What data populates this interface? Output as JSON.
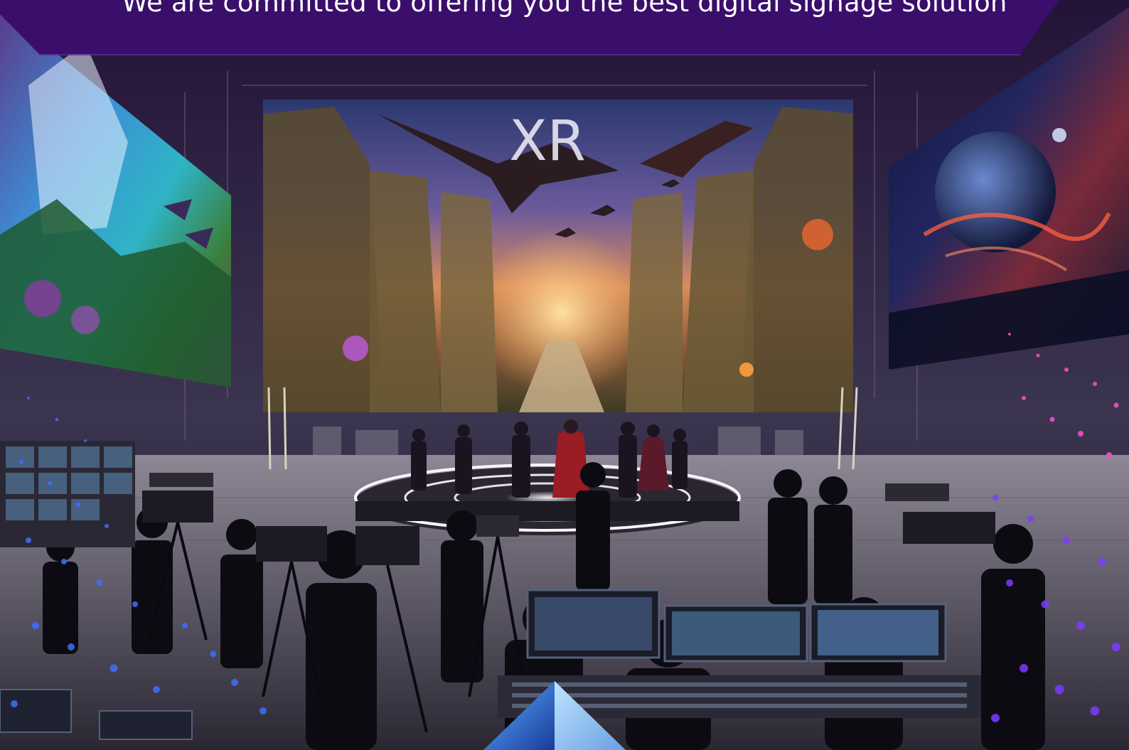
{
  "banner": {
    "text": "We are committed to offering you the best digital signage solution"
  },
  "center_screen": {
    "label": "XR"
  },
  "colors": {
    "banner": "#3a0f6b",
    "accent_purple": "#7a3cff",
    "accent_pink": "#ff4fc8",
    "dot_blue": "#3f6dff"
  },
  "icons": {
    "logo": "pyramid-logo-icon"
  }
}
